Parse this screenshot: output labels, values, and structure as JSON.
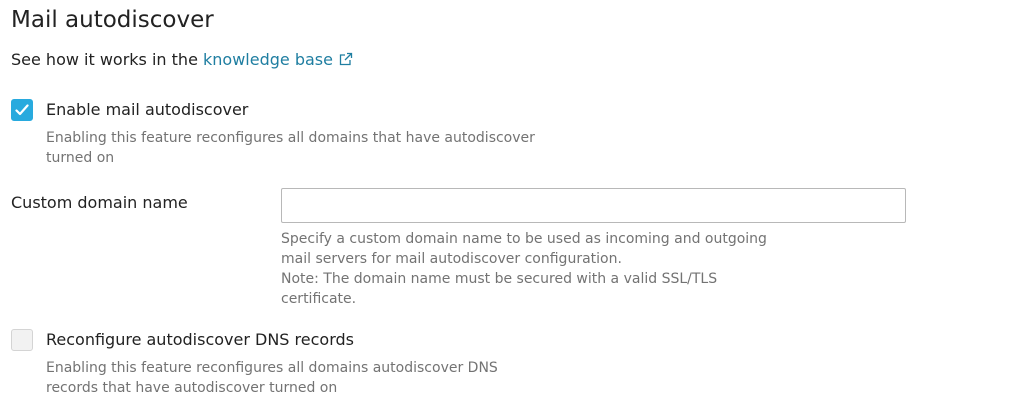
{
  "section": {
    "title": "Mail autodiscover",
    "kb_prefix": "See how it works in the ",
    "kb_link": "knowledge base"
  },
  "enable_autodiscover": {
    "label": "Enable mail autodiscover",
    "checked": true,
    "hint": "Enabling this feature reconfigures all domains that have autodiscover\nturned on"
  },
  "custom_domain": {
    "label": "Custom domain name",
    "value": "",
    "placeholder": "",
    "hint": "Specify a custom domain name to be used as incoming and outgoing\nmail servers for mail autodiscover configuration.\nNote: The domain name must be secured with a valid SSL/TLS\ncertificate."
  },
  "reconfigure_dns": {
    "label": "Reconfigure autodiscover DNS records",
    "checked": false,
    "hint": "Enabling this feature reconfigures all domains autodiscover DNS\nrecords that have autodiscover turned on"
  },
  "colors": {
    "accent": "#28aade",
    "link": "#1f7ea1",
    "hint_text": "#737373"
  },
  "icons": {
    "external_link": "external-link-icon",
    "checkmark": "checkmark-icon"
  }
}
